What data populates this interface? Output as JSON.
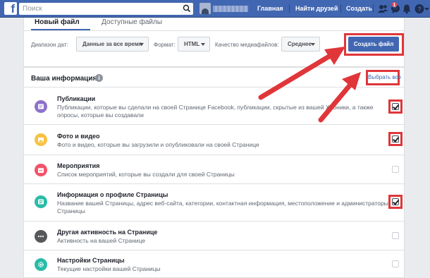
{
  "topbar": {
    "logo": "f",
    "search_placeholder": "Поиск",
    "nav_home": "Главная",
    "nav_find_friends": "Найти друзей",
    "nav_create": "Создать",
    "notifications_count": "1",
    "brand_color": "#4267b2"
  },
  "tabs": {
    "active": "Новый файл",
    "inactive": "Доступные файлы"
  },
  "options": {
    "date_range_label": "Диапазон дат:",
    "date_range_value": "Данные за все время",
    "format_label": "Формат:",
    "format_value": "HTML",
    "media_quality_label": "Качество медиафайлов:",
    "media_quality_value": "Среднее",
    "create_button": "Создать файл"
  },
  "info": {
    "title": "Ваша информация",
    "info_icon": "i",
    "select_all": "Выбрать все",
    "highlight_color": "#e0363a",
    "items": [
      {
        "title": "Публикации",
        "description": "Публикации, которые вы сделали на своей Странице Facebook, публикации, скрытые из вашей Хроники, а также опросы, которые вы создавали",
        "icon": "post-icon",
        "color": "#8c72cb",
        "checked": true
      },
      {
        "title": "Фото и видео",
        "description": "Фото и видео, которые вы загрузили и опубликовали на своей Странице",
        "icon": "photo-icon",
        "color": "#f7c244",
        "checked": true
      },
      {
        "title": "Мероприятия",
        "description": "Список мероприятий, которые вы создали для своей Страницы",
        "icon": "calendar-icon",
        "color": "#f35369",
        "checked": false
      },
      {
        "title": "Информация о профиле Страницы",
        "description": "Название вашей Страницы, адрес веб-сайта, категории, контактная информация, местоположение и администраторы Страницы",
        "icon": "profile-info-icon",
        "color": "#2abba7",
        "checked": true
      },
      {
        "title": "Другая активность на Странице",
        "description": "Активность на вашей Странице",
        "icon": "more-icon",
        "color": "#57585a",
        "checked": false
      },
      {
        "title": "Настройки Страницы",
        "description": "Текущие настройки вашей Страницы",
        "icon": "gear-icon",
        "color": "#2abba7",
        "checked": false
      }
    ]
  }
}
